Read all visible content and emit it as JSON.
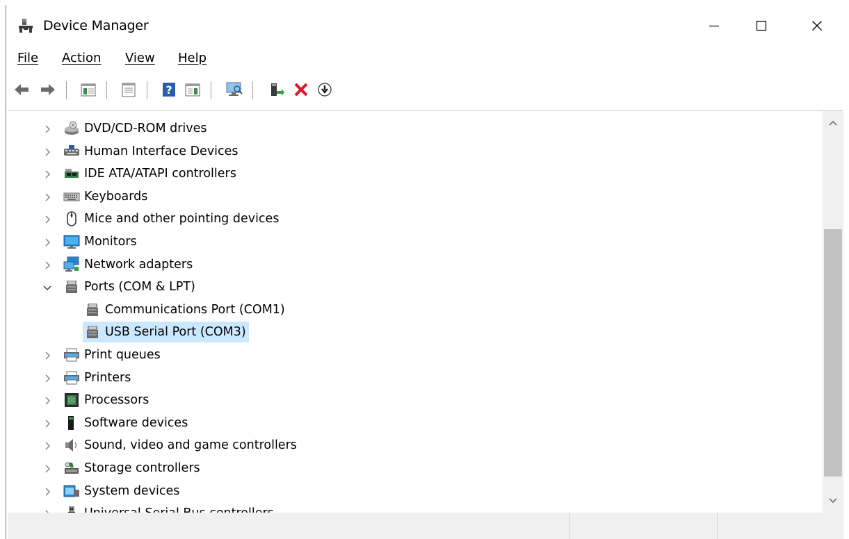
{
  "window": {
    "title": "Device Manager"
  },
  "menu": {
    "file": "File",
    "action": "Action",
    "view": "View",
    "help": "Help"
  },
  "toolbar": {
    "buttons": [
      "back-icon",
      "forward-icon",
      "show-hide-console-tree-icon",
      "properties-icon",
      "help-icon",
      "action-pane-icon",
      "scan-hardware-icon",
      "update-driver-icon",
      "uninstall-icon",
      "disable-device-icon"
    ]
  },
  "tree": {
    "items": [
      {
        "label": "DVD/CD-ROM drives",
        "icon": "dvd-drive-icon",
        "expanded": false
      },
      {
        "label": "Human Interface Devices",
        "icon": "hid-icon",
        "expanded": false
      },
      {
        "label": "IDE ATA/ATAPI controllers",
        "icon": "ide-controller-icon",
        "expanded": false
      },
      {
        "label": "Keyboards",
        "icon": "keyboard-icon",
        "expanded": false
      },
      {
        "label": "Mice and other pointing devices",
        "icon": "mouse-icon",
        "expanded": false
      },
      {
        "label": "Monitors",
        "icon": "monitor-icon",
        "expanded": false
      },
      {
        "label": "Network adapters",
        "icon": "network-adapter-icon",
        "expanded": false
      },
      {
        "label": "Ports (COM & LPT)",
        "icon": "port-icon",
        "expanded": true
      },
      {
        "label": "Communications Port (COM1)",
        "icon": "port-icon",
        "child": true
      },
      {
        "label": "USB Serial Port (COM3)",
        "icon": "port-icon",
        "child": true,
        "selected": true
      },
      {
        "label": "Print queues",
        "icon": "printer-icon",
        "expanded": false
      },
      {
        "label": "Printers",
        "icon": "printer-icon",
        "expanded": false
      },
      {
        "label": "Processors",
        "icon": "processor-icon",
        "expanded": false
      },
      {
        "label": "Software devices",
        "icon": "software-device-icon",
        "expanded": false
      },
      {
        "label": "Sound, video and game controllers",
        "icon": "speaker-icon",
        "expanded": false
      },
      {
        "label": "Storage controllers",
        "icon": "storage-controller-icon",
        "expanded": false
      },
      {
        "label": "System devices",
        "icon": "system-device-icon",
        "expanded": false
      },
      {
        "label": "Universal Serial Bus controllers",
        "icon": "usb-icon",
        "expanded": false
      }
    ]
  },
  "colors": {
    "selection": "#cce8ff",
    "accent_red": "#e81123"
  }
}
